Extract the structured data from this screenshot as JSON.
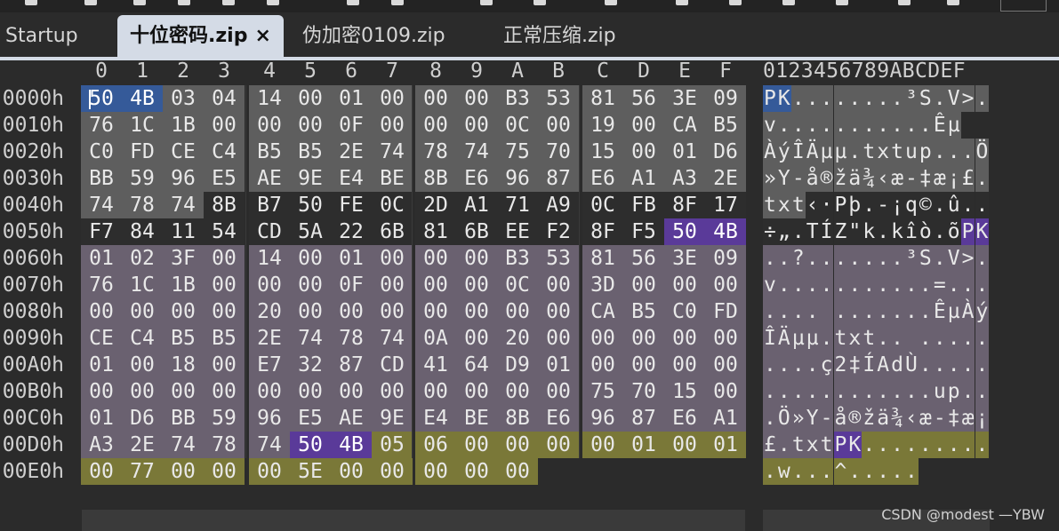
{
  "tabs": [
    {
      "label": "Startup",
      "active": false
    },
    {
      "label": "十位密码.zip",
      "active": true,
      "close": "×"
    },
    {
      "label": "伪加密0109.zip",
      "active": false
    },
    {
      "label": "正常压缩.zip",
      "active": false
    }
  ],
  "column_headers": [
    "0",
    "1",
    "2",
    "3",
    "4",
    "5",
    "6",
    "7",
    "8",
    "9",
    "A",
    "B",
    "C",
    "D",
    "E",
    "F"
  ],
  "ascii_header": "0123456789ABCDEF",
  "offsets": [
    "0000h",
    "0010h",
    "0020h",
    "0030h",
    "0040h",
    "0050h",
    "0060h",
    "0070h",
    "0080h",
    "0090h",
    "00A0h",
    "00B0h",
    "00C0h",
    "00D0h",
    "00E0h"
  ],
  "hex_rows": [
    [
      "50",
      "4B",
      "03",
      "04",
      "14",
      "00",
      "01",
      "00",
      "00",
      "00",
      "B3",
      "53",
      "81",
      "56",
      "3E",
      "09"
    ],
    [
      "76",
      "1C",
      "1B",
      "00",
      "00",
      "00",
      "0F",
      "00",
      "00",
      "00",
      "0C",
      "00",
      "19",
      "00",
      "CA",
      "B5"
    ],
    [
      "C0",
      "FD",
      "CE",
      "C4",
      "B5",
      "B5",
      "2E",
      "74",
      "78",
      "74",
      "75",
      "70",
      "15",
      "00",
      "01",
      "D6"
    ],
    [
      "BB",
      "59",
      "96",
      "E5",
      "AE",
      "9E",
      "E4",
      "BE",
      "8B",
      "E6",
      "96",
      "87",
      "E6",
      "A1",
      "A3",
      "2E"
    ],
    [
      "74",
      "78",
      "74",
      "8B",
      "B7",
      "50",
      "FE",
      "0C",
      "2D",
      "A1",
      "71",
      "A9",
      "0C",
      "FB",
      "8F",
      "17"
    ],
    [
      "F7",
      "84",
      "11",
      "54",
      "CD",
      "5A",
      "22",
      "6B",
      "81",
      "6B",
      "EE",
      "F2",
      "8F",
      "F5",
      "50",
      "4B"
    ],
    [
      "01",
      "02",
      "3F",
      "00",
      "14",
      "00",
      "01",
      "00",
      "00",
      "00",
      "B3",
      "53",
      "81",
      "56",
      "3E",
      "09"
    ],
    [
      "76",
      "1C",
      "1B",
      "00",
      "00",
      "00",
      "0F",
      "00",
      "00",
      "00",
      "0C",
      "00",
      "3D",
      "00",
      "00",
      "00"
    ],
    [
      "00",
      "00",
      "00",
      "00",
      "20",
      "00",
      "00",
      "00",
      "00",
      "00",
      "00",
      "00",
      "CA",
      "B5",
      "C0",
      "FD"
    ],
    [
      "CE",
      "C4",
      "B5",
      "B5",
      "2E",
      "74",
      "78",
      "74",
      "0A",
      "00",
      "20",
      "00",
      "00",
      "00",
      "00",
      "00"
    ],
    [
      "01",
      "00",
      "18",
      "00",
      "E7",
      "32",
      "87",
      "CD",
      "41",
      "64",
      "D9",
      "01",
      "00",
      "00",
      "00",
      "00"
    ],
    [
      "00",
      "00",
      "00",
      "00",
      "00",
      "00",
      "00",
      "00",
      "00",
      "00",
      "00",
      "00",
      "75",
      "70",
      "15",
      "00"
    ],
    [
      "01",
      "D6",
      "BB",
      "59",
      "96",
      "E5",
      "AE",
      "9E",
      "E4",
      "BE",
      "8B",
      "E6",
      "96",
      "87",
      "E6",
      "A1"
    ],
    [
      "A3",
      "2E",
      "74",
      "78",
      "74",
      "50",
      "4B",
      "05",
      "06",
      "00",
      "00",
      "00",
      "00",
      "01",
      "00",
      "01"
    ],
    [
      "00",
      "77",
      "00",
      "00",
      "00",
      "5E",
      "00",
      "00",
      "00",
      "00",
      "00"
    ]
  ],
  "ascii_rows": [
    "PK........³S.V>.",
    "v...........Êµ",
    "ÀýÎÄµµ.txtup...Ö",
    "»Y-å®žä¾‹æ-‡æ¡£.",
    "txt‹·Pþ.-¡q©.û..",
    "÷„.TÍZ\"k.kîò.õPK",
    "..?.......³S.V>.",
    "v...........=...",
    ".... .......ÊµÀý",
    "ÎÄµµ.txt.. .....",
    "....ç2‡ÍAdÙ.....",
    "............up..",
    ".Ö»Y-å®žä¾‹æ-‡æ¡",
    "£.txtPK.........",
    ".w...^....."
  ],
  "highlight_colors": {
    "gray": "#5e5e5e",
    "mauve": "#6a6170",
    "olive": "#7a7838",
    "blue": "#355a99",
    "purple": "#5a3a99"
  },
  "watermark": "CSDN @modest —YBW"
}
